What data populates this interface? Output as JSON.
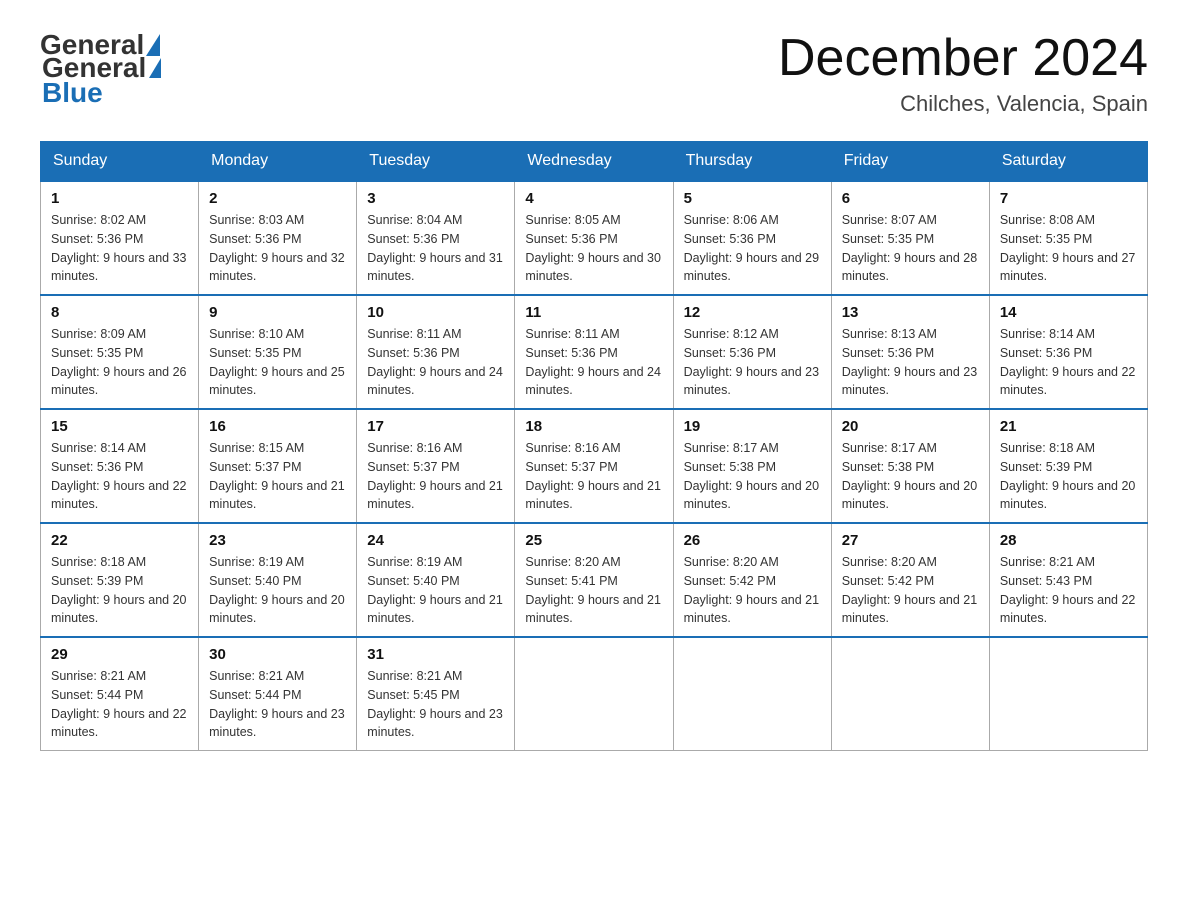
{
  "header": {
    "logo_general": "General",
    "logo_blue": "Blue",
    "title": "December 2024",
    "location": "Chilches, Valencia, Spain"
  },
  "days_of_week": [
    "Sunday",
    "Monday",
    "Tuesday",
    "Wednesday",
    "Thursday",
    "Friday",
    "Saturday"
  ],
  "weeks": [
    [
      {
        "day": "1",
        "sunrise": "8:02 AM",
        "sunset": "5:36 PM",
        "daylight": "9 hours and 33 minutes."
      },
      {
        "day": "2",
        "sunrise": "8:03 AM",
        "sunset": "5:36 PM",
        "daylight": "9 hours and 32 minutes."
      },
      {
        "day": "3",
        "sunrise": "8:04 AM",
        "sunset": "5:36 PM",
        "daylight": "9 hours and 31 minutes."
      },
      {
        "day": "4",
        "sunrise": "8:05 AM",
        "sunset": "5:36 PM",
        "daylight": "9 hours and 30 minutes."
      },
      {
        "day": "5",
        "sunrise": "8:06 AM",
        "sunset": "5:36 PM",
        "daylight": "9 hours and 29 minutes."
      },
      {
        "day": "6",
        "sunrise": "8:07 AM",
        "sunset": "5:35 PM",
        "daylight": "9 hours and 28 minutes."
      },
      {
        "day": "7",
        "sunrise": "8:08 AM",
        "sunset": "5:35 PM",
        "daylight": "9 hours and 27 minutes."
      }
    ],
    [
      {
        "day": "8",
        "sunrise": "8:09 AM",
        "sunset": "5:35 PM",
        "daylight": "9 hours and 26 minutes."
      },
      {
        "day": "9",
        "sunrise": "8:10 AM",
        "sunset": "5:35 PM",
        "daylight": "9 hours and 25 minutes."
      },
      {
        "day": "10",
        "sunrise": "8:11 AM",
        "sunset": "5:36 PM",
        "daylight": "9 hours and 24 minutes."
      },
      {
        "day": "11",
        "sunrise": "8:11 AM",
        "sunset": "5:36 PM",
        "daylight": "9 hours and 24 minutes."
      },
      {
        "day": "12",
        "sunrise": "8:12 AM",
        "sunset": "5:36 PM",
        "daylight": "9 hours and 23 minutes."
      },
      {
        "day": "13",
        "sunrise": "8:13 AM",
        "sunset": "5:36 PM",
        "daylight": "9 hours and 23 minutes."
      },
      {
        "day": "14",
        "sunrise": "8:14 AM",
        "sunset": "5:36 PM",
        "daylight": "9 hours and 22 minutes."
      }
    ],
    [
      {
        "day": "15",
        "sunrise": "8:14 AM",
        "sunset": "5:36 PM",
        "daylight": "9 hours and 22 minutes."
      },
      {
        "day": "16",
        "sunrise": "8:15 AM",
        "sunset": "5:37 PM",
        "daylight": "9 hours and 21 minutes."
      },
      {
        "day": "17",
        "sunrise": "8:16 AM",
        "sunset": "5:37 PM",
        "daylight": "9 hours and 21 minutes."
      },
      {
        "day": "18",
        "sunrise": "8:16 AM",
        "sunset": "5:37 PM",
        "daylight": "9 hours and 21 minutes."
      },
      {
        "day": "19",
        "sunrise": "8:17 AM",
        "sunset": "5:38 PM",
        "daylight": "9 hours and 20 minutes."
      },
      {
        "day": "20",
        "sunrise": "8:17 AM",
        "sunset": "5:38 PM",
        "daylight": "9 hours and 20 minutes."
      },
      {
        "day": "21",
        "sunrise": "8:18 AM",
        "sunset": "5:39 PM",
        "daylight": "9 hours and 20 minutes."
      }
    ],
    [
      {
        "day": "22",
        "sunrise": "8:18 AM",
        "sunset": "5:39 PM",
        "daylight": "9 hours and 20 minutes."
      },
      {
        "day": "23",
        "sunrise": "8:19 AM",
        "sunset": "5:40 PM",
        "daylight": "9 hours and 20 minutes."
      },
      {
        "day": "24",
        "sunrise": "8:19 AM",
        "sunset": "5:40 PM",
        "daylight": "9 hours and 21 minutes."
      },
      {
        "day": "25",
        "sunrise": "8:20 AM",
        "sunset": "5:41 PM",
        "daylight": "9 hours and 21 minutes."
      },
      {
        "day": "26",
        "sunrise": "8:20 AM",
        "sunset": "5:42 PM",
        "daylight": "9 hours and 21 minutes."
      },
      {
        "day": "27",
        "sunrise": "8:20 AM",
        "sunset": "5:42 PM",
        "daylight": "9 hours and 21 minutes."
      },
      {
        "day": "28",
        "sunrise": "8:21 AM",
        "sunset": "5:43 PM",
        "daylight": "9 hours and 22 minutes."
      }
    ],
    [
      {
        "day": "29",
        "sunrise": "8:21 AM",
        "sunset": "5:44 PM",
        "daylight": "9 hours and 22 minutes."
      },
      {
        "day": "30",
        "sunrise": "8:21 AM",
        "sunset": "5:44 PM",
        "daylight": "9 hours and 23 minutes."
      },
      {
        "day": "31",
        "sunrise": "8:21 AM",
        "sunset": "5:45 PM",
        "daylight": "9 hours and 23 minutes."
      },
      null,
      null,
      null,
      null
    ]
  ]
}
